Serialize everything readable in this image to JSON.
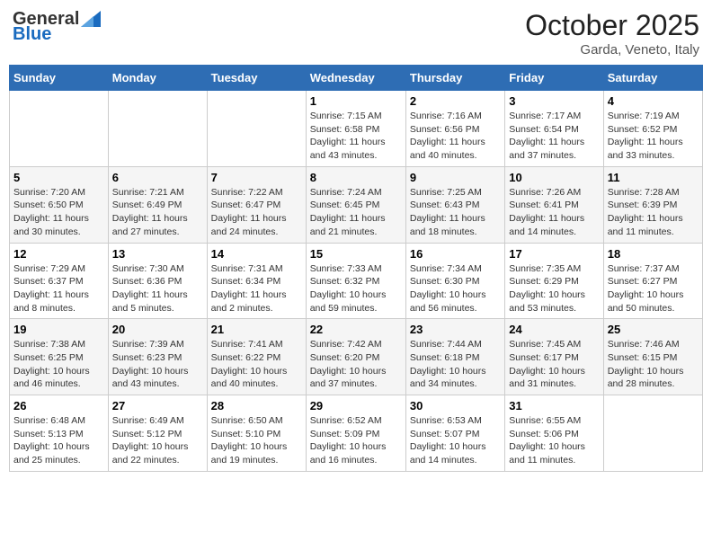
{
  "header": {
    "logo_general": "General",
    "logo_blue": "Blue",
    "title": "October 2025",
    "subtitle": "Garda, Veneto, Italy"
  },
  "weekdays": [
    "Sunday",
    "Monday",
    "Tuesday",
    "Wednesday",
    "Thursday",
    "Friday",
    "Saturday"
  ],
  "weeks": [
    [
      {
        "day": "",
        "info": ""
      },
      {
        "day": "",
        "info": ""
      },
      {
        "day": "",
        "info": ""
      },
      {
        "day": "1",
        "info": "Sunrise: 7:15 AM\nSunset: 6:58 PM\nDaylight: 11 hours and 43 minutes."
      },
      {
        "day": "2",
        "info": "Sunrise: 7:16 AM\nSunset: 6:56 PM\nDaylight: 11 hours and 40 minutes."
      },
      {
        "day": "3",
        "info": "Sunrise: 7:17 AM\nSunset: 6:54 PM\nDaylight: 11 hours and 37 minutes."
      },
      {
        "day": "4",
        "info": "Sunrise: 7:19 AM\nSunset: 6:52 PM\nDaylight: 11 hours and 33 minutes."
      }
    ],
    [
      {
        "day": "5",
        "info": "Sunrise: 7:20 AM\nSunset: 6:50 PM\nDaylight: 11 hours and 30 minutes."
      },
      {
        "day": "6",
        "info": "Sunrise: 7:21 AM\nSunset: 6:49 PM\nDaylight: 11 hours and 27 minutes."
      },
      {
        "day": "7",
        "info": "Sunrise: 7:22 AM\nSunset: 6:47 PM\nDaylight: 11 hours and 24 minutes."
      },
      {
        "day": "8",
        "info": "Sunrise: 7:24 AM\nSunset: 6:45 PM\nDaylight: 11 hours and 21 minutes."
      },
      {
        "day": "9",
        "info": "Sunrise: 7:25 AM\nSunset: 6:43 PM\nDaylight: 11 hours and 18 minutes."
      },
      {
        "day": "10",
        "info": "Sunrise: 7:26 AM\nSunset: 6:41 PM\nDaylight: 11 hours and 14 minutes."
      },
      {
        "day": "11",
        "info": "Sunrise: 7:28 AM\nSunset: 6:39 PM\nDaylight: 11 hours and 11 minutes."
      }
    ],
    [
      {
        "day": "12",
        "info": "Sunrise: 7:29 AM\nSunset: 6:37 PM\nDaylight: 11 hours and 8 minutes."
      },
      {
        "day": "13",
        "info": "Sunrise: 7:30 AM\nSunset: 6:36 PM\nDaylight: 11 hours and 5 minutes."
      },
      {
        "day": "14",
        "info": "Sunrise: 7:31 AM\nSunset: 6:34 PM\nDaylight: 11 hours and 2 minutes."
      },
      {
        "day": "15",
        "info": "Sunrise: 7:33 AM\nSunset: 6:32 PM\nDaylight: 10 hours and 59 minutes."
      },
      {
        "day": "16",
        "info": "Sunrise: 7:34 AM\nSunset: 6:30 PM\nDaylight: 10 hours and 56 minutes."
      },
      {
        "day": "17",
        "info": "Sunrise: 7:35 AM\nSunset: 6:29 PM\nDaylight: 10 hours and 53 minutes."
      },
      {
        "day": "18",
        "info": "Sunrise: 7:37 AM\nSunset: 6:27 PM\nDaylight: 10 hours and 50 minutes."
      }
    ],
    [
      {
        "day": "19",
        "info": "Sunrise: 7:38 AM\nSunset: 6:25 PM\nDaylight: 10 hours and 46 minutes."
      },
      {
        "day": "20",
        "info": "Sunrise: 7:39 AM\nSunset: 6:23 PM\nDaylight: 10 hours and 43 minutes."
      },
      {
        "day": "21",
        "info": "Sunrise: 7:41 AM\nSunset: 6:22 PM\nDaylight: 10 hours and 40 minutes."
      },
      {
        "day": "22",
        "info": "Sunrise: 7:42 AM\nSunset: 6:20 PM\nDaylight: 10 hours and 37 minutes."
      },
      {
        "day": "23",
        "info": "Sunrise: 7:44 AM\nSunset: 6:18 PM\nDaylight: 10 hours and 34 minutes."
      },
      {
        "day": "24",
        "info": "Sunrise: 7:45 AM\nSunset: 6:17 PM\nDaylight: 10 hours and 31 minutes."
      },
      {
        "day": "25",
        "info": "Sunrise: 7:46 AM\nSunset: 6:15 PM\nDaylight: 10 hours and 28 minutes."
      }
    ],
    [
      {
        "day": "26",
        "info": "Sunrise: 6:48 AM\nSunset: 5:13 PM\nDaylight: 10 hours and 25 minutes."
      },
      {
        "day": "27",
        "info": "Sunrise: 6:49 AM\nSunset: 5:12 PM\nDaylight: 10 hours and 22 minutes."
      },
      {
        "day": "28",
        "info": "Sunrise: 6:50 AM\nSunset: 5:10 PM\nDaylight: 10 hours and 19 minutes."
      },
      {
        "day": "29",
        "info": "Sunrise: 6:52 AM\nSunset: 5:09 PM\nDaylight: 10 hours and 16 minutes."
      },
      {
        "day": "30",
        "info": "Sunrise: 6:53 AM\nSunset: 5:07 PM\nDaylight: 10 hours and 14 minutes."
      },
      {
        "day": "31",
        "info": "Sunrise: 6:55 AM\nSunset: 5:06 PM\nDaylight: 10 hours and 11 minutes."
      },
      {
        "day": "",
        "info": ""
      }
    ]
  ]
}
